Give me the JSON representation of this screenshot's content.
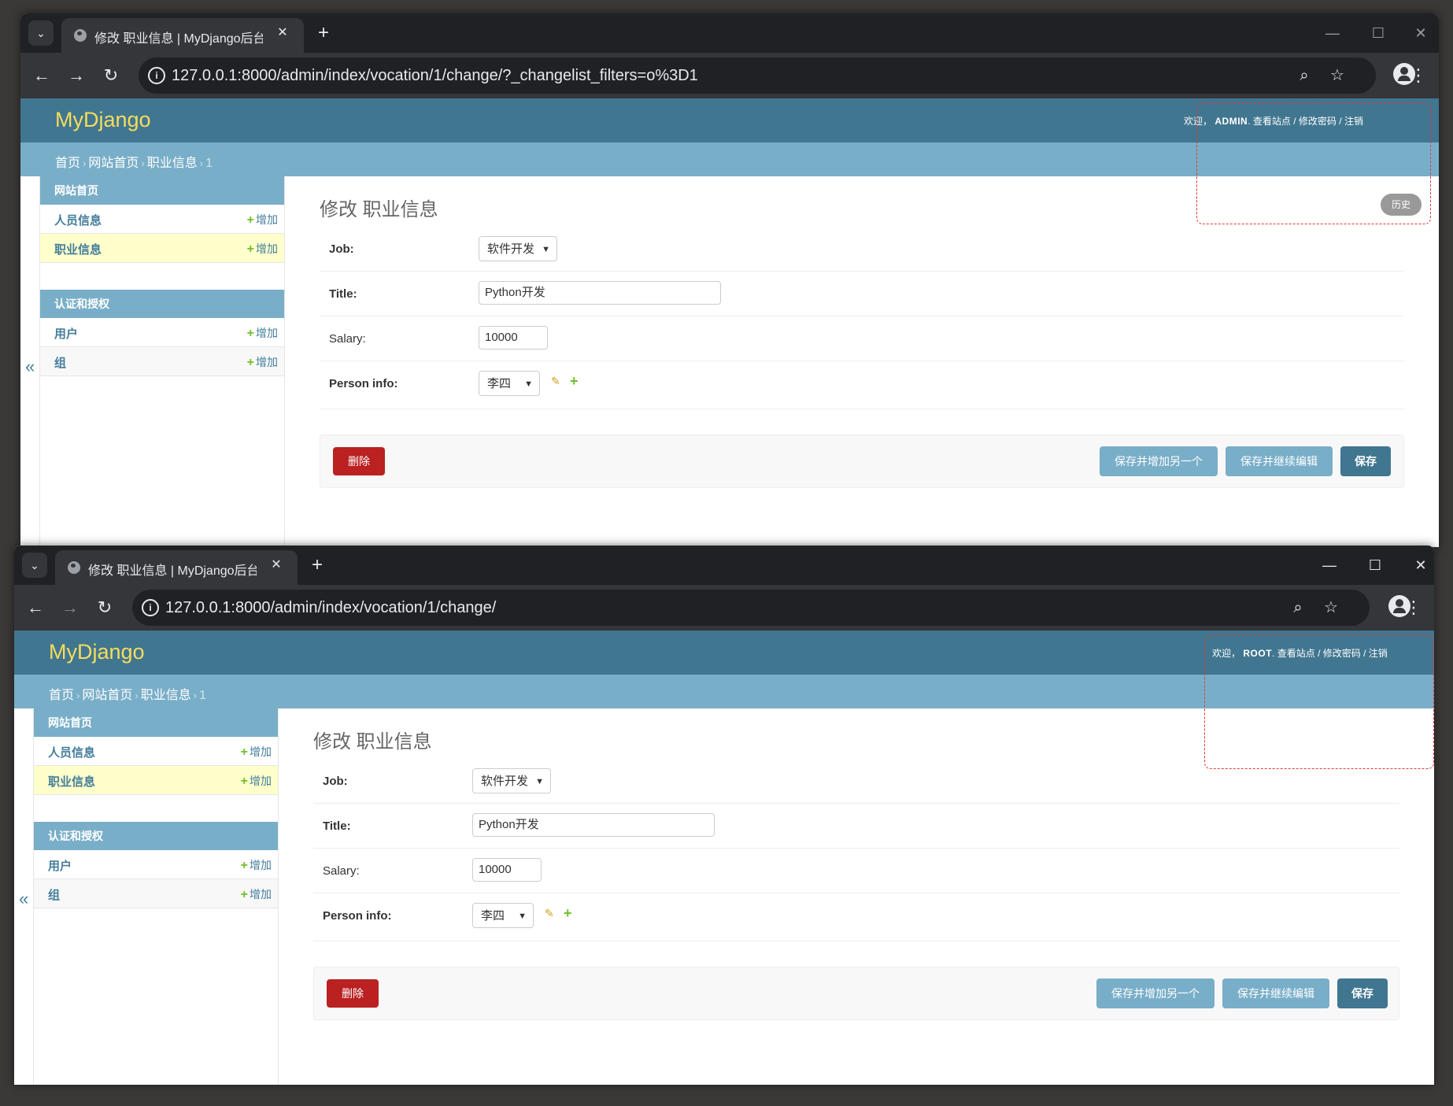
{
  "windows": [
    {
      "tab_title": "修改 职业信息 | MyDjango后台",
      "url": "127.0.0.1:8000/admin/index/vocation/1/change/?_changelist_filters=o%3D1",
      "brand": "MyDjango",
      "user_tools": {
        "welcome": "欢迎，",
        "user": "ADMIN",
        "view_site": "查看站点",
        "change_password": "修改密码",
        "logout": "注销",
        "sep": "/"
      },
      "breadcrumbs": [
        "首页",
        "网站首页",
        "职业信息",
        "1"
      ],
      "sidebar": {
        "group1": {
          "caption": "网站首页",
          "items": [
            {
              "label": "人员信息",
              "add": "增加"
            },
            {
              "label": "职业信息",
              "add": "增加"
            }
          ]
        },
        "group2": {
          "caption": "认证和授权",
          "items": [
            {
              "label": "用户",
              "add": "增加"
            },
            {
              "label": "组",
              "add": "增加"
            }
          ]
        }
      },
      "collapse": "«",
      "title": "修改 职业信息",
      "history": "历史",
      "form": {
        "job_label": "Job:",
        "job_value": "软件开发",
        "title_label": "Title:",
        "title_value": "Python开发",
        "salary_label": "Salary:",
        "salary_value": "10000",
        "person_label": "Person info:",
        "person_value": "李四"
      },
      "buttons": {
        "delete": "删除",
        "save_add": "保存并增加另一个",
        "save_continue": "保存并继续编辑",
        "save": "保存"
      }
    },
    {
      "tab_title": "修改 职业信息 | MyDjango后台",
      "url": "127.0.0.1:8000/admin/index/vocation/1/change/",
      "brand": "MyDjango",
      "user_tools": {
        "welcome": "欢迎，",
        "user": "ROOT",
        "view_site": "查看站点",
        "change_password": "修改密码",
        "logout": "注销",
        "sep": "/"
      },
      "breadcrumbs": [
        "首页",
        "网站首页",
        "职业信息",
        "1"
      ],
      "sidebar": {
        "group1": {
          "caption": "网站首页",
          "items": [
            {
              "label": "人员信息",
              "add": "增加"
            },
            {
              "label": "职业信息",
              "add": "增加"
            }
          ]
        },
        "group2": {
          "caption": "认证和授权",
          "items": [
            {
              "label": "用户",
              "add": "增加"
            },
            {
              "label": "组",
              "add": "增加"
            }
          ]
        }
      },
      "collapse": "«",
      "title": "修改 职业信息",
      "form": {
        "job_label": "Job:",
        "job_value": "软件开发",
        "title_label": "Title:",
        "title_value": "Python开发",
        "salary_label": "Salary:",
        "salary_value": "10000",
        "person_label": "Person info:",
        "person_value": "李四"
      },
      "buttons": {
        "delete": "删除",
        "save_add": "保存并增加另一个",
        "save_continue": "保存并继续编辑",
        "save": "保存"
      }
    }
  ],
  "icons": {
    "tab_dropdown": "chevron-down-icon",
    "favicon": "globe-icon",
    "close": "close-icon",
    "new_tab": "plus-icon",
    "back": "arrow-left-icon",
    "forward": "arrow-right-icon",
    "reload": "reload-icon",
    "zoom": "zoom-icon",
    "bookmark": "star-icon",
    "profile": "profile-icon",
    "menu": "kebab-icon",
    "pencil": "pencil-icon",
    "add": "plus-icon"
  },
  "colors": {
    "header": "#417690",
    "breadcrumbs": "#79aec8",
    "brand": "#f5dd5d",
    "delete": "#ba2121",
    "highlight": "#e03a3a"
  }
}
